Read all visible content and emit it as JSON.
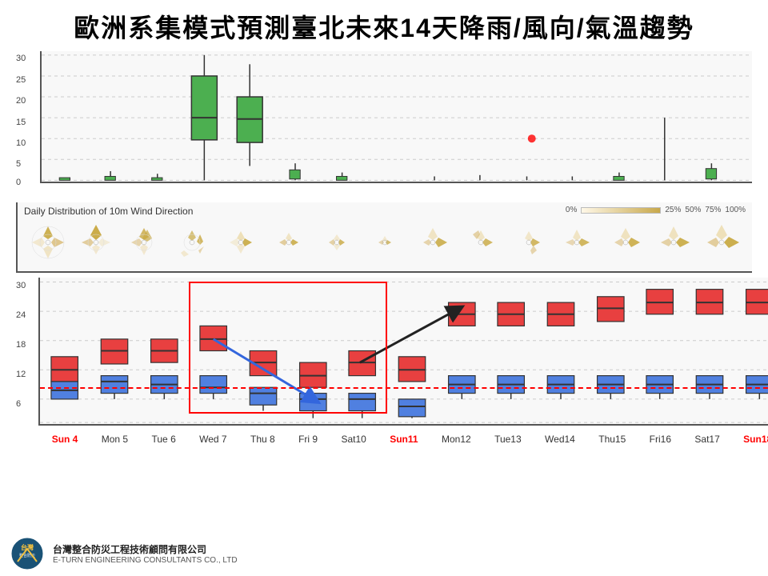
{
  "title": "歐洲系集模式預測臺北未來14天降雨/風向/氣溫趨勢",
  "chart1": {
    "y_labels": [
      "30",
      "25",
      "20",
      "15",
      "10",
      "5",
      "0"
    ],
    "y_values": [
      30,
      25,
      20,
      15,
      10,
      5,
      0
    ]
  },
  "wind": {
    "title": "Daily Distribution of 10m Wind Direction",
    "legend_labels": [
      "0%",
      "25%",
      "50%",
      "75%",
      "100%"
    ]
  },
  "chart2": {
    "y_labels": [
      "30",
      "24",
      "18",
      "12",
      "6"
    ],
    "y_values": [
      30,
      24,
      18,
      12,
      6
    ]
  },
  "x_labels": [
    {
      "text": "Sun 4",
      "color": "red"
    },
    {
      "text": "Mon 5",
      "color": "normal"
    },
    {
      "text": "Tue 6",
      "color": "normal"
    },
    {
      "text": "Wed 7",
      "color": "normal"
    },
    {
      "text": "Thu 8",
      "color": "normal"
    },
    {
      "text": "Fri 9",
      "color": "normal"
    },
    {
      "text": "Sat10",
      "color": "normal"
    },
    {
      "text": "Sun11",
      "color": "red"
    },
    {
      "text": "Mon12",
      "color": "normal"
    },
    {
      "text": "Tue13",
      "color": "normal"
    },
    {
      "text": "Wed14",
      "color": "normal"
    },
    {
      "text": "Thu15",
      "color": "normal"
    },
    {
      "text": "Fri16",
      "color": "normal"
    },
    {
      "text": "Sat17",
      "color": "normal"
    },
    {
      "text": "Sun18",
      "color": "red"
    }
  ],
  "footer": {
    "company_zh": "台灣整合防災工程技術顧問有限公司",
    "company_en": "E-TURN ENGINEERING CONSULTANTS CO., LTD"
  }
}
